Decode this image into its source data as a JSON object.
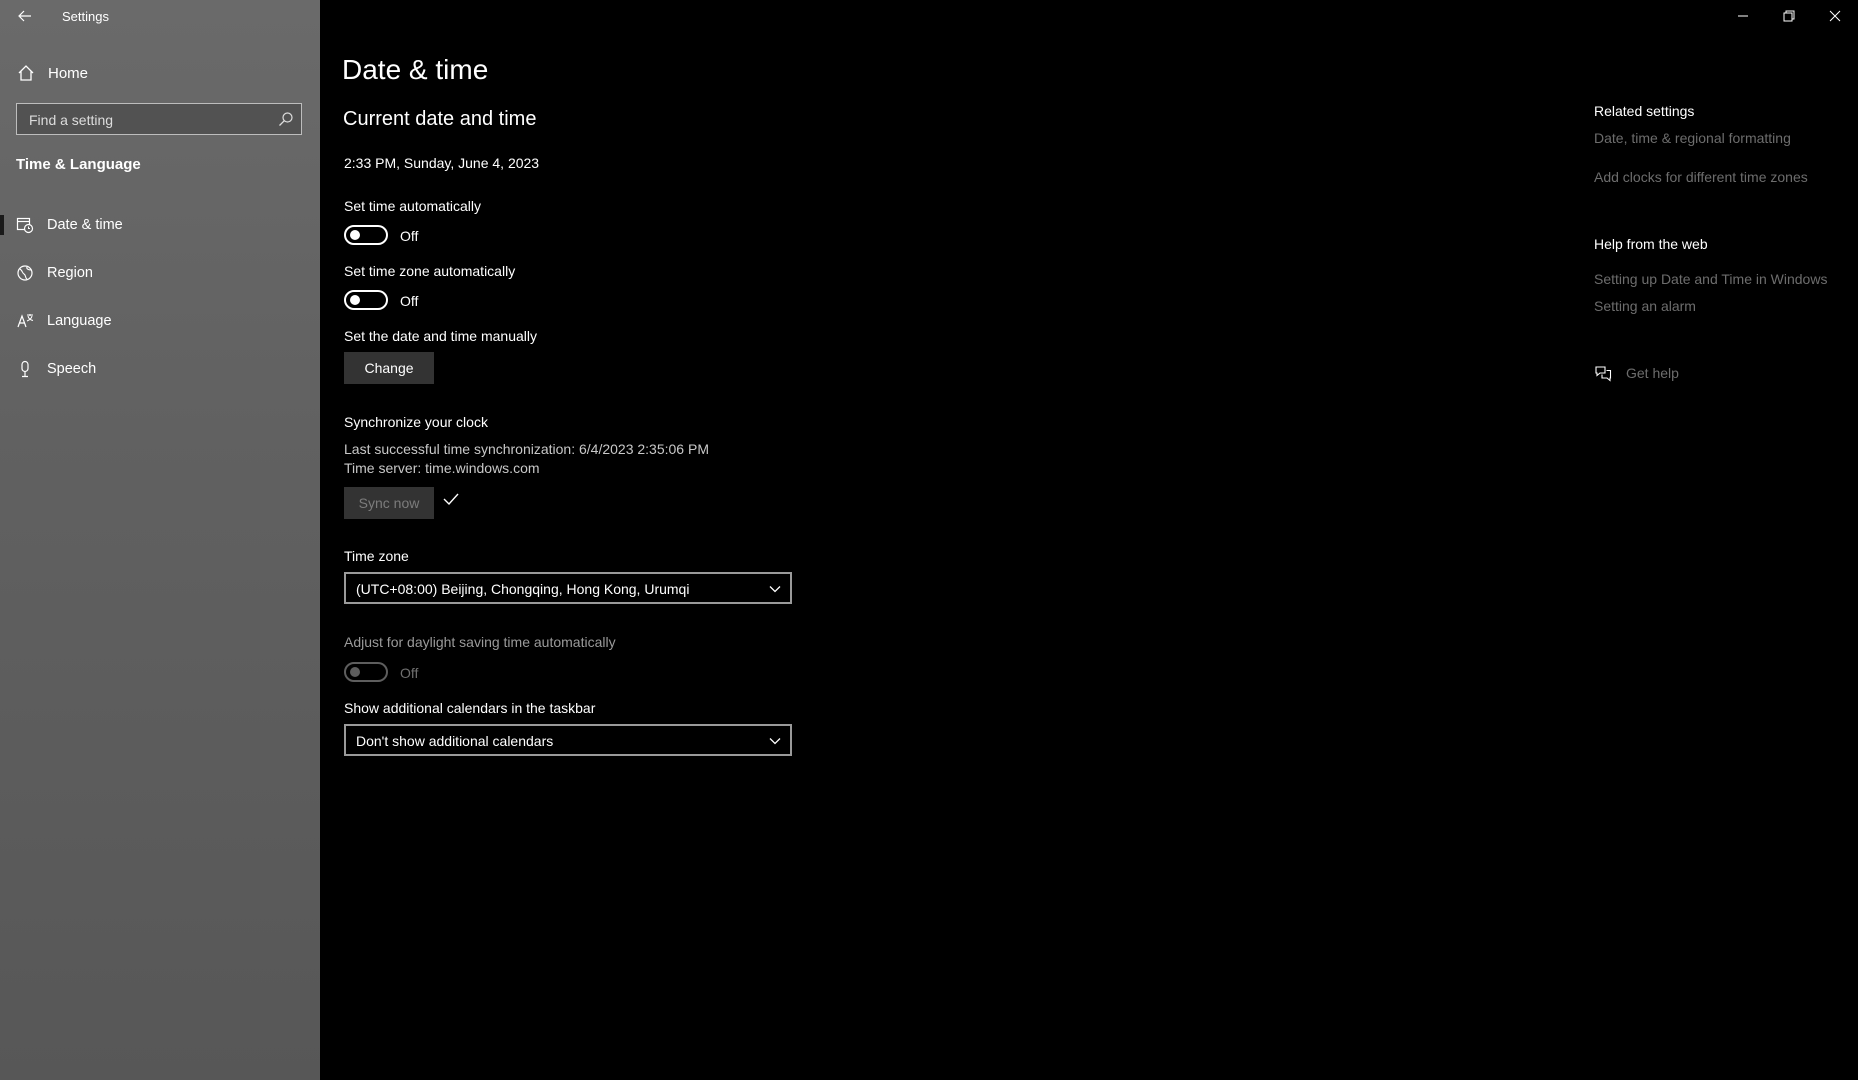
{
  "app": {
    "title": "Settings"
  },
  "sidebar": {
    "home_label": "Home",
    "search": {
      "placeholder": "Find a setting"
    },
    "section_title": "Time & Language",
    "items": [
      {
        "label": "Date & time",
        "icon": "calendar-clock-icon",
        "selected": true
      },
      {
        "label": "Region",
        "icon": "globe-icon",
        "selected": false
      },
      {
        "label": "Language",
        "icon": "language-icon",
        "selected": false
      },
      {
        "label": "Speech",
        "icon": "microphone-icon",
        "selected": false
      }
    ]
  },
  "main": {
    "page_title": "Date & time",
    "current_heading": "Current date and time",
    "current_value": "2:33 PM, Sunday, June 4, 2023",
    "set_time_auto": {
      "label": "Set time automatically",
      "state": "Off"
    },
    "set_timezone_auto": {
      "label": "Set time zone automatically",
      "state": "Off"
    },
    "manual": {
      "label": "Set the date and time manually",
      "button": "Change"
    },
    "sync": {
      "label": "Synchronize your clock",
      "last_sync": "Last successful time synchronization: 6/4/2023 2:35:06 PM",
      "server": "Time server: time.windows.com",
      "button": "Sync now"
    },
    "timezone": {
      "label": "Time zone",
      "value": "(UTC+08:00) Beijing, Chongqing, Hong Kong, Urumqi"
    },
    "dst": {
      "label": "Adjust for daylight saving time automatically",
      "state": "Off"
    },
    "calendars": {
      "label": "Show additional calendars in the taskbar",
      "value": "Don't show additional calendars"
    }
  },
  "right": {
    "related_title": "Related settings",
    "related_links": [
      "Date, time & regional formatting",
      "Add clocks for different time zones"
    ],
    "help_title": "Help from the web",
    "help_links": [
      "Setting up Date and Time in Windows",
      "Setting an alarm"
    ],
    "get_help": "Get help"
  },
  "colors": {
    "sidebar_bg": "#616161",
    "content_bg": "#000000",
    "link_dim": "#6d6d6d"
  }
}
